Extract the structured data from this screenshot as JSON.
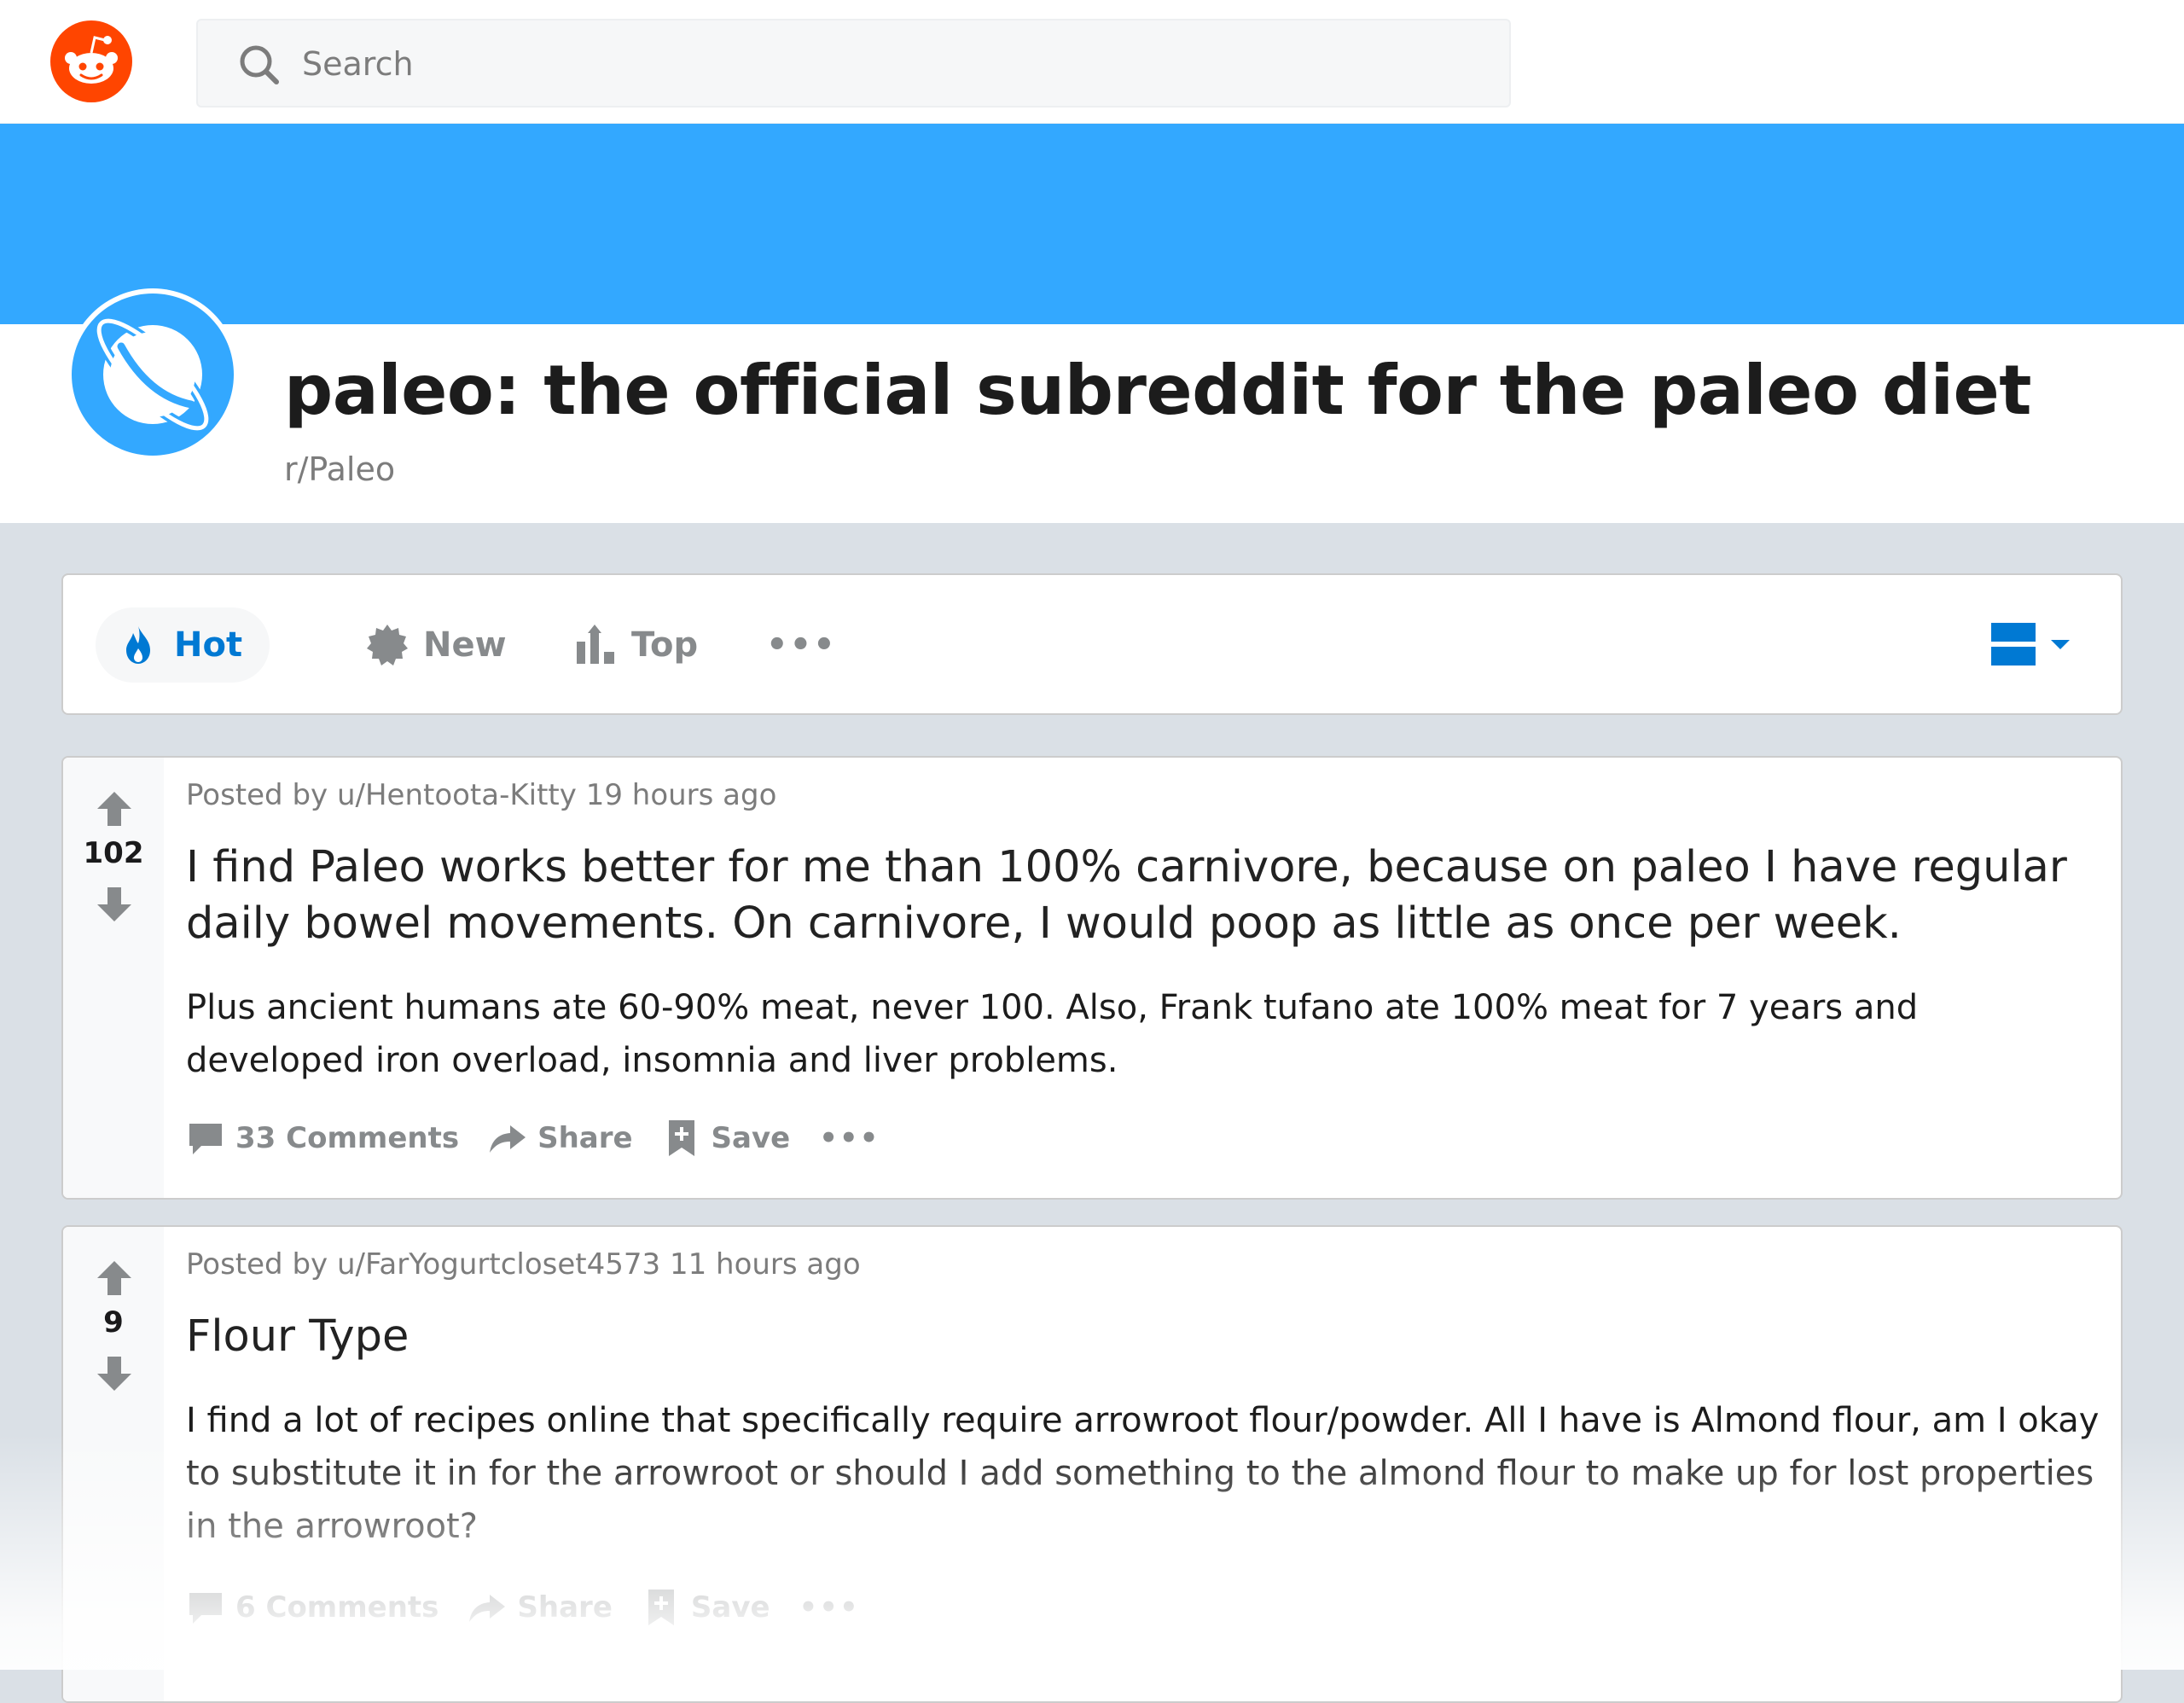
{
  "search": {
    "placeholder": "Search"
  },
  "subreddit": {
    "title": "paleo: the official subreddit for the paleo diet",
    "name": "r/Paleo",
    "banner_color": "#33a8ff"
  },
  "sort": {
    "items": [
      {
        "label": "Hot",
        "icon": "flame-icon",
        "active": true
      },
      {
        "label": "New",
        "icon": "badge-icon"
      },
      {
        "label": "Top",
        "icon": "top-chart-icon"
      }
    ],
    "more": "•••"
  },
  "posts": [
    {
      "votes": "102",
      "meta": "Posted by u/Hentoota-Kitty 19 hours ago",
      "title": "I find Paleo works better for me than 100% carnivore, because on paleo I have regular daily bowel movements. On carnivore, I would poop as little as once per week.",
      "body": "Plus ancient humans ate 60-90% meat, never 100. Also, Frank tufano ate 100% meat for 7 years and developed iron overload, insomnia and liver problems.",
      "comments": "33 Comments",
      "share": "Share",
      "save": "Save",
      "more": "•••"
    },
    {
      "votes": "9",
      "meta": "Posted by u/FarYogurtcloset4573 11 hours ago",
      "title": "Flour Type",
      "body": "I find a lot of recipes online that specifically require arrowroot flour/powder. All I have is Almond flour, am I okay to substitute it in for the arrowroot or should I add something to the almond flour to make up for lost properties in the arrowroot?",
      "comments": "6 Comments",
      "share": "Share",
      "save": "Save",
      "more": "•••"
    }
  ],
  "colors": {
    "accent": "#0079d3",
    "reddit_orange": "#ff4500",
    "muted": "#878a8c",
    "page_bg": "#dae0e6"
  }
}
